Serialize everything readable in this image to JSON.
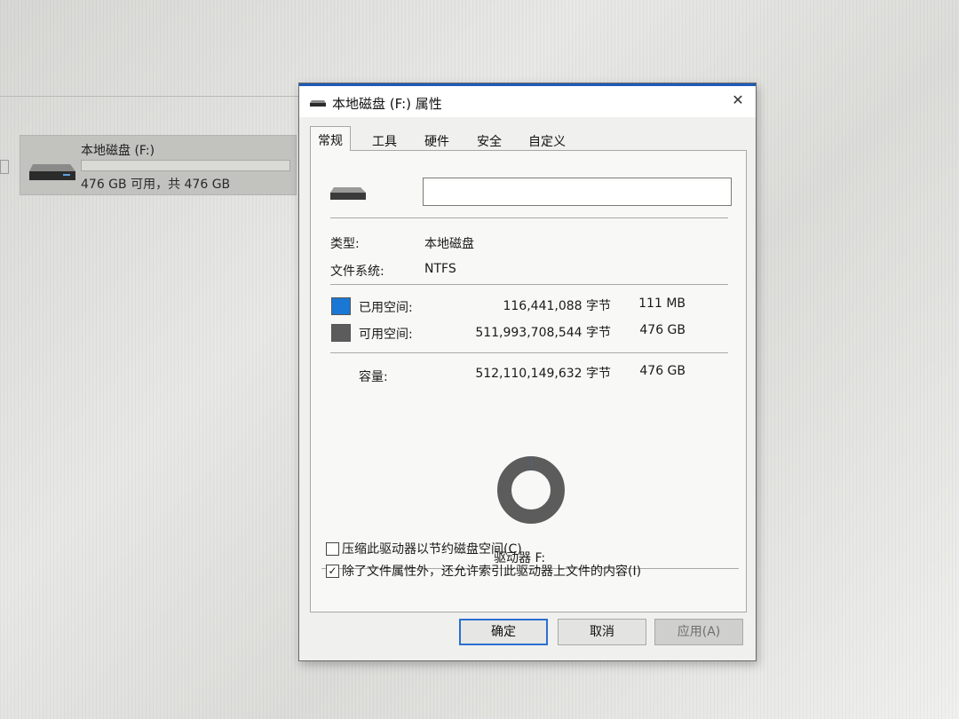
{
  "explorer": {
    "drive_name": "本地磁盘 (F:)",
    "drive_free": "476 GB 可用，共 476 GB"
  },
  "dialog": {
    "title": "本地磁盘 (F:) 属性",
    "close_glyph": "✕",
    "tabs": [
      "常规",
      "工具",
      "硬件",
      "安全",
      "自定义"
    ],
    "active_tab": "常规",
    "volume_label_value": "",
    "type_label": "类型:",
    "type_value": "本地磁盘",
    "fs_label": "文件系统:",
    "fs_value": "NTFS",
    "used": {
      "label": "已用空间:",
      "bytes": "116,441,088 字节",
      "size": "111 MB",
      "color": "#1a78d4"
    },
    "free": {
      "label": "可用空间:",
      "bytes": "511,993,708,544 字节",
      "size": "476 GB",
      "color": "#5c5c5c"
    },
    "capacity": {
      "label": "容量:",
      "bytes": "512,110,149,632 字节",
      "size": "476 GB"
    },
    "usage_fraction": 0.000227,
    "drive_caption": "驱动器 F:",
    "compress_label": "压缩此驱动器以节约磁盘空间(C)",
    "compress_checked": false,
    "index_label": "除了文件属性外，还允许索引此驱动器上文件的内容(I)",
    "index_checked": true,
    "check_glyph": "✓",
    "buttons": {
      "ok": "确定",
      "cancel": "取消",
      "apply": "应用(A)"
    }
  }
}
